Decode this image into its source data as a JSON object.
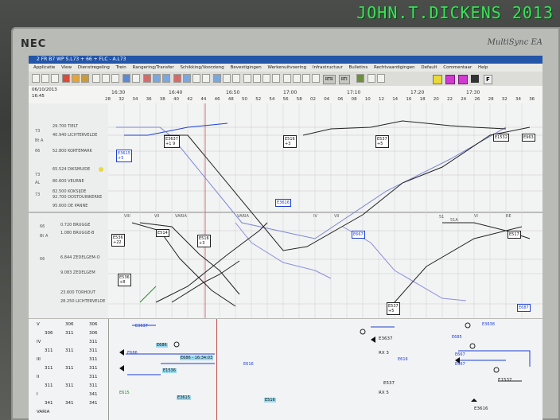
{
  "watermark": "JOHN.T.DICKENS 2013",
  "monitor": {
    "brand": "NEC",
    "model": "MultiSync EA"
  },
  "window": {
    "title": "2 FR B7 WP S.L73 + 66 + FLC - A.L73"
  },
  "menu": [
    "Applicatie",
    "View",
    "Dienstregeling",
    "Trein",
    "Rangering/Transfer",
    "Schikking/Voorzieng",
    "Bevestigingen",
    "Werkenuitvoering",
    "Infrastructuur",
    "Bulletins",
    "Rechtvaardigingen",
    "Default",
    "Commentaar",
    "Help"
  ],
  "toolbar": {
    "rtr_label": "RTR",
    "rti_label": "RTI",
    "f_label": "F"
  },
  "timeline": {
    "date": "06/10/2013",
    "time": "16:45",
    "hours": [
      "16:30",
      "16:40",
      "16:50",
      "17:00",
      "17:10",
      "17:20",
      "17:30"
    ],
    "minutes": [
      "28",
      "32",
      "34",
      "36",
      "38",
      "40",
      "42",
      "44",
      "46",
      "48",
      "50",
      "52",
      "54",
      "56",
      "58",
      "02",
      "04",
      "06",
      "08",
      "10",
      "12",
      "14",
      "16",
      "18",
      "20",
      "22",
      "24",
      "26",
      "28",
      "32",
      "34",
      "36"
    ]
  },
  "upper_stations": [
    {
      "line": "73",
      "name": "29.700 TIELT"
    },
    {
      "line": "73",
      "name": "40.940 LICHTERVELDE"
    },
    {
      "line": "66",
      "name": "52.800 KORTEMARK"
    },
    {
      "line": "73",
      "name": "65.524 DIKSMUIDE"
    },
    {
      "line": "73",
      "name": "80.600 VEURNE"
    },
    {
      "line": "73",
      "name": "82.500 KOKSIJDE"
    },
    {
      "line": "73",
      "name": "92.700 OOSTDUINKERKE"
    },
    {
      "line": "73",
      "name": "95.600 DE PANNE"
    }
  ],
  "upper_track_labels": [
    "Bt A",
    "Bt A",
    "AL",
    "AL"
  ],
  "lower_stations": [
    {
      "line": "66",
      "name": "0.720 BRUGGE"
    },
    {
      "line": "66",
      "name": "1.080 BRUGGE-B"
    },
    {
      "line": "66",
      "name": "6.844 ZEDELGEM-O"
    },
    {
      "line": "66",
      "name": "9.083 ZEDELGEM"
    },
    {
      "line": "66",
      "name": "23.600 TORHOUT"
    },
    {
      "line": "66",
      "name": "28.250 LICHTERVELDE"
    }
  ],
  "train_labels_upper": [
    {
      "id": "E3637",
      "sub": "+1 9"
    },
    {
      "id": "E3615",
      "sub": "+5"
    },
    {
      "id": "E516",
      "sub": "+3"
    },
    {
      "id": "E537",
      "sub": "+5"
    },
    {
      "id": "E1532",
      "sub": ""
    },
    {
      "id": "E963",
      "sub": ""
    },
    {
      "id": "E3616",
      "sub": ""
    }
  ],
  "train_labels_lower": [
    {
      "id": "E536",
      "sub": "+22"
    },
    {
      "id": "E514",
      "sub": ""
    },
    {
      "id": "E516",
      "sub": "+3"
    },
    {
      "id": "E536",
      "sub": "+8"
    },
    {
      "id": "E667",
      "sub": ""
    },
    {
      "id": "E537",
      "sub": "+5"
    },
    {
      "id": "E517",
      "sub": ""
    },
    {
      "id": "E687",
      "sub": ""
    }
  ],
  "platform_markers": [
    "VIII",
    "VII",
    "VARIA",
    "VARIA",
    "IV",
    "VII",
    "51",
    "51",
    "51A",
    "51A",
    "VI",
    "VI",
    "RE"
  ],
  "track_table": {
    "rows": [
      {
        "track": "V",
        "a": "",
        "b": "306",
        "c": "306"
      },
      {
        "track": "",
        "a": "306",
        "b": "311",
        "c": "306"
      },
      {
        "track": "IV",
        "a": "",
        "b": "",
        "c": "311"
      },
      {
        "track": "",
        "a": "311",
        "b": "311",
        "c": "311"
      },
      {
        "track": "III",
        "a": "",
        "b": "",
        "c": "311"
      },
      {
        "track": "",
        "a": "311",
        "b": "311",
        "c": "311"
      },
      {
        "track": "II",
        "a": "",
        "b": "",
        "c": "311"
      },
      {
        "track": "",
        "a": "311",
        "b": "311",
        "c": "311"
      },
      {
        "track": "I",
        "a": "",
        "b": "",
        "c": "341"
      },
      {
        "track": "",
        "a": "341",
        "b": "341",
        "c": "341"
      },
      {
        "track": "VARIA",
        "a": "",
        "b": "",
        "c": ""
      }
    ]
  },
  "occupancy_labels": [
    "E3637",
    "E686",
    "E686 - 16:34:03",
    "E1536",
    "E616",
    "E3615",
    "E516",
    "E3637",
    "RX 3",
    "E616",
    "E685",
    "E667",
    "E667",
    "E1537",
    "E3616",
    "E615",
    "E537",
    "E3638",
    "RX 5"
  ]
}
